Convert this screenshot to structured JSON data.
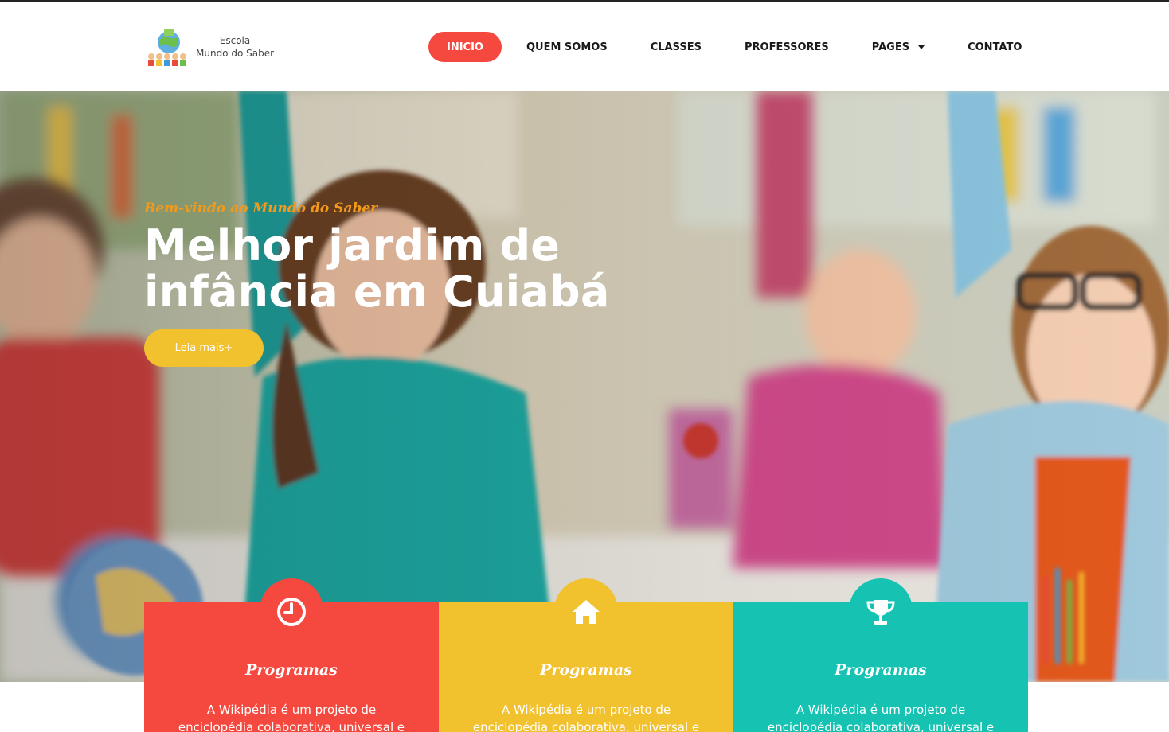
{
  "brand": {
    "line1": "Escola",
    "line2": "Mundo do Saber"
  },
  "nav": {
    "items": [
      {
        "label": "INICIO",
        "active": true
      },
      {
        "label": "QUEM SOMOS"
      },
      {
        "label": "CLASSES"
      },
      {
        "label": "PROFESSORES"
      },
      {
        "label": "PAGES",
        "dropdown": true
      },
      {
        "label": "CONTATO"
      }
    ]
  },
  "hero": {
    "welcome": "Bem-vindo ao Mundo do Saber",
    "headline_line1": "Melhor jardim de",
    "headline_line2": "infância em Cuiabá",
    "cta_label": "Leia mais+"
  },
  "features": [
    {
      "icon": "clock-icon",
      "title": "Programas",
      "desc": "A Wikipédia é um projeto de enciclopédia colaborativa, universal e multilíngue",
      "color": "#f5483f"
    },
    {
      "icon": "home-icon",
      "title": "Programas",
      "desc": "A Wikipédia é um projeto de enciclopédia colaborativa, universal e multilíngue",
      "color": "#f2c12e"
    },
    {
      "icon": "trophy-icon",
      "title": "Programas",
      "desc": "A Wikipédia é um projeto de enciclopédia colaborativa, universal e multilíngue",
      "color": "#16c2b1"
    }
  ],
  "colors": {
    "accent": "#f5483f",
    "yellow": "#f2c12e",
    "teal": "#16c2b1",
    "orange_text": "#f39a1c"
  }
}
